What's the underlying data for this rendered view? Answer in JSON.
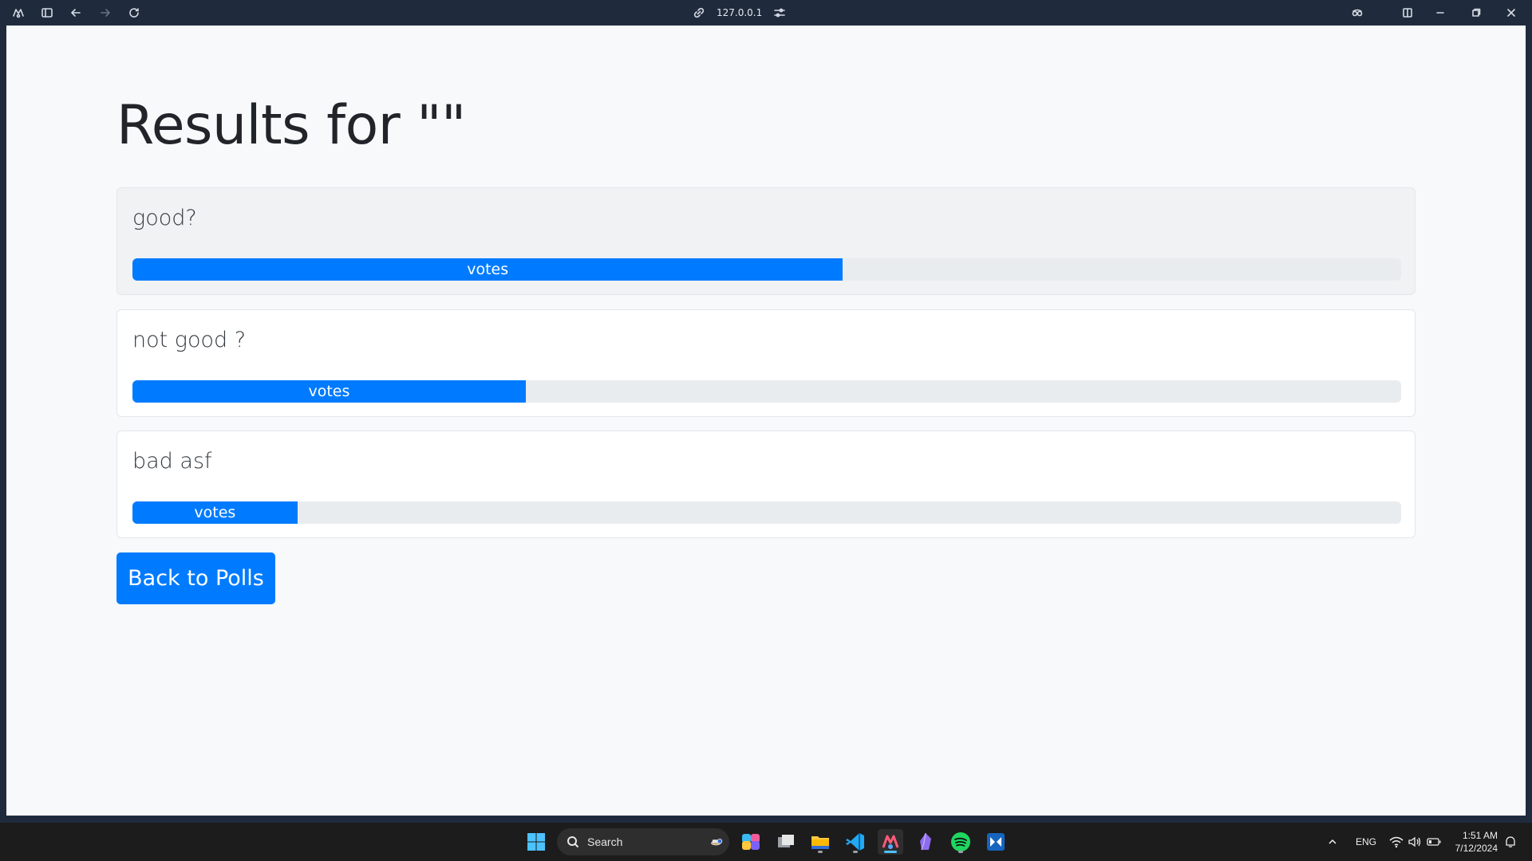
{
  "browser": {
    "url": "127.0.0.1"
  },
  "page": {
    "title": "Results for \"\"",
    "options": [
      {
        "label": "good?",
        "bar_label": "votes",
        "fraction": 0.56
      },
      {
        "label": "not good ?",
        "bar_label": "votes",
        "fraction": 0.31
      },
      {
        "label": "bad asf",
        "bar_label": "votes",
        "fraction": 0.13
      }
    ],
    "back_button": "Back to Polls",
    "colors": {
      "primary": "#007bff",
      "track": "#e9ecef",
      "text": "#212529"
    }
  },
  "taskbar": {
    "search_label": "Search",
    "language": "ENG",
    "time": "1:51 AM",
    "date": "7/12/2024",
    "icons": [
      "windows-start-icon",
      "copilot-icon",
      "task-view-icon",
      "file-explorer-icon",
      "vscode-icon",
      "browser-icon",
      "obsidian-icon",
      "spotify-icon",
      "app-icon"
    ]
  }
}
